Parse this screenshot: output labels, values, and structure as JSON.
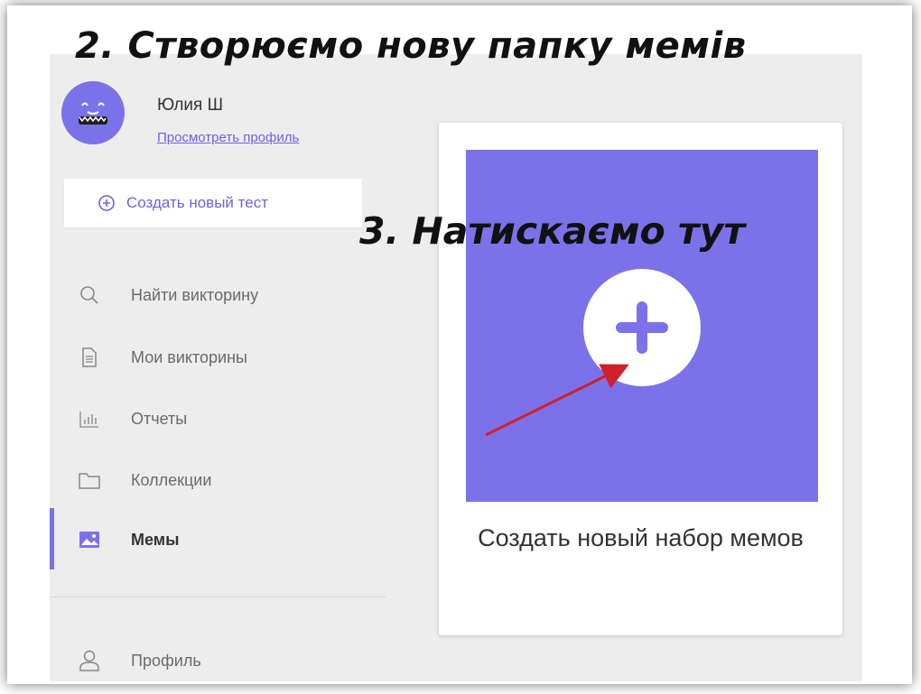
{
  "annotations": {
    "step2": "2. Створюємо нову папку мемів",
    "step3": "3. Натискаємо тут"
  },
  "user": {
    "name": "Юлия Ш",
    "profile_link": "Просмотреть профиль"
  },
  "create_test": {
    "label": "Создать новый тест",
    "icon": "plus-circle-icon"
  },
  "nav": {
    "items": [
      {
        "label": "Найти викторину",
        "icon": "search-icon"
      },
      {
        "label": "Мои викторины",
        "icon": "document-icon"
      },
      {
        "label": "Отчеты",
        "icon": "bar-chart-icon"
      },
      {
        "label": "Коллекции",
        "icon": "folder-icon"
      },
      {
        "label": "Мемы",
        "icon": "image-icon",
        "active": true
      },
      {
        "label": "Профиль",
        "icon": "user-icon"
      }
    ]
  },
  "card": {
    "title": "Создать новый набор мемов",
    "icon": "plus-icon"
  },
  "colors": {
    "accent": "#7b72e9",
    "link": "#6d63de",
    "background": "#ededed",
    "arrow": "#d0202a"
  }
}
